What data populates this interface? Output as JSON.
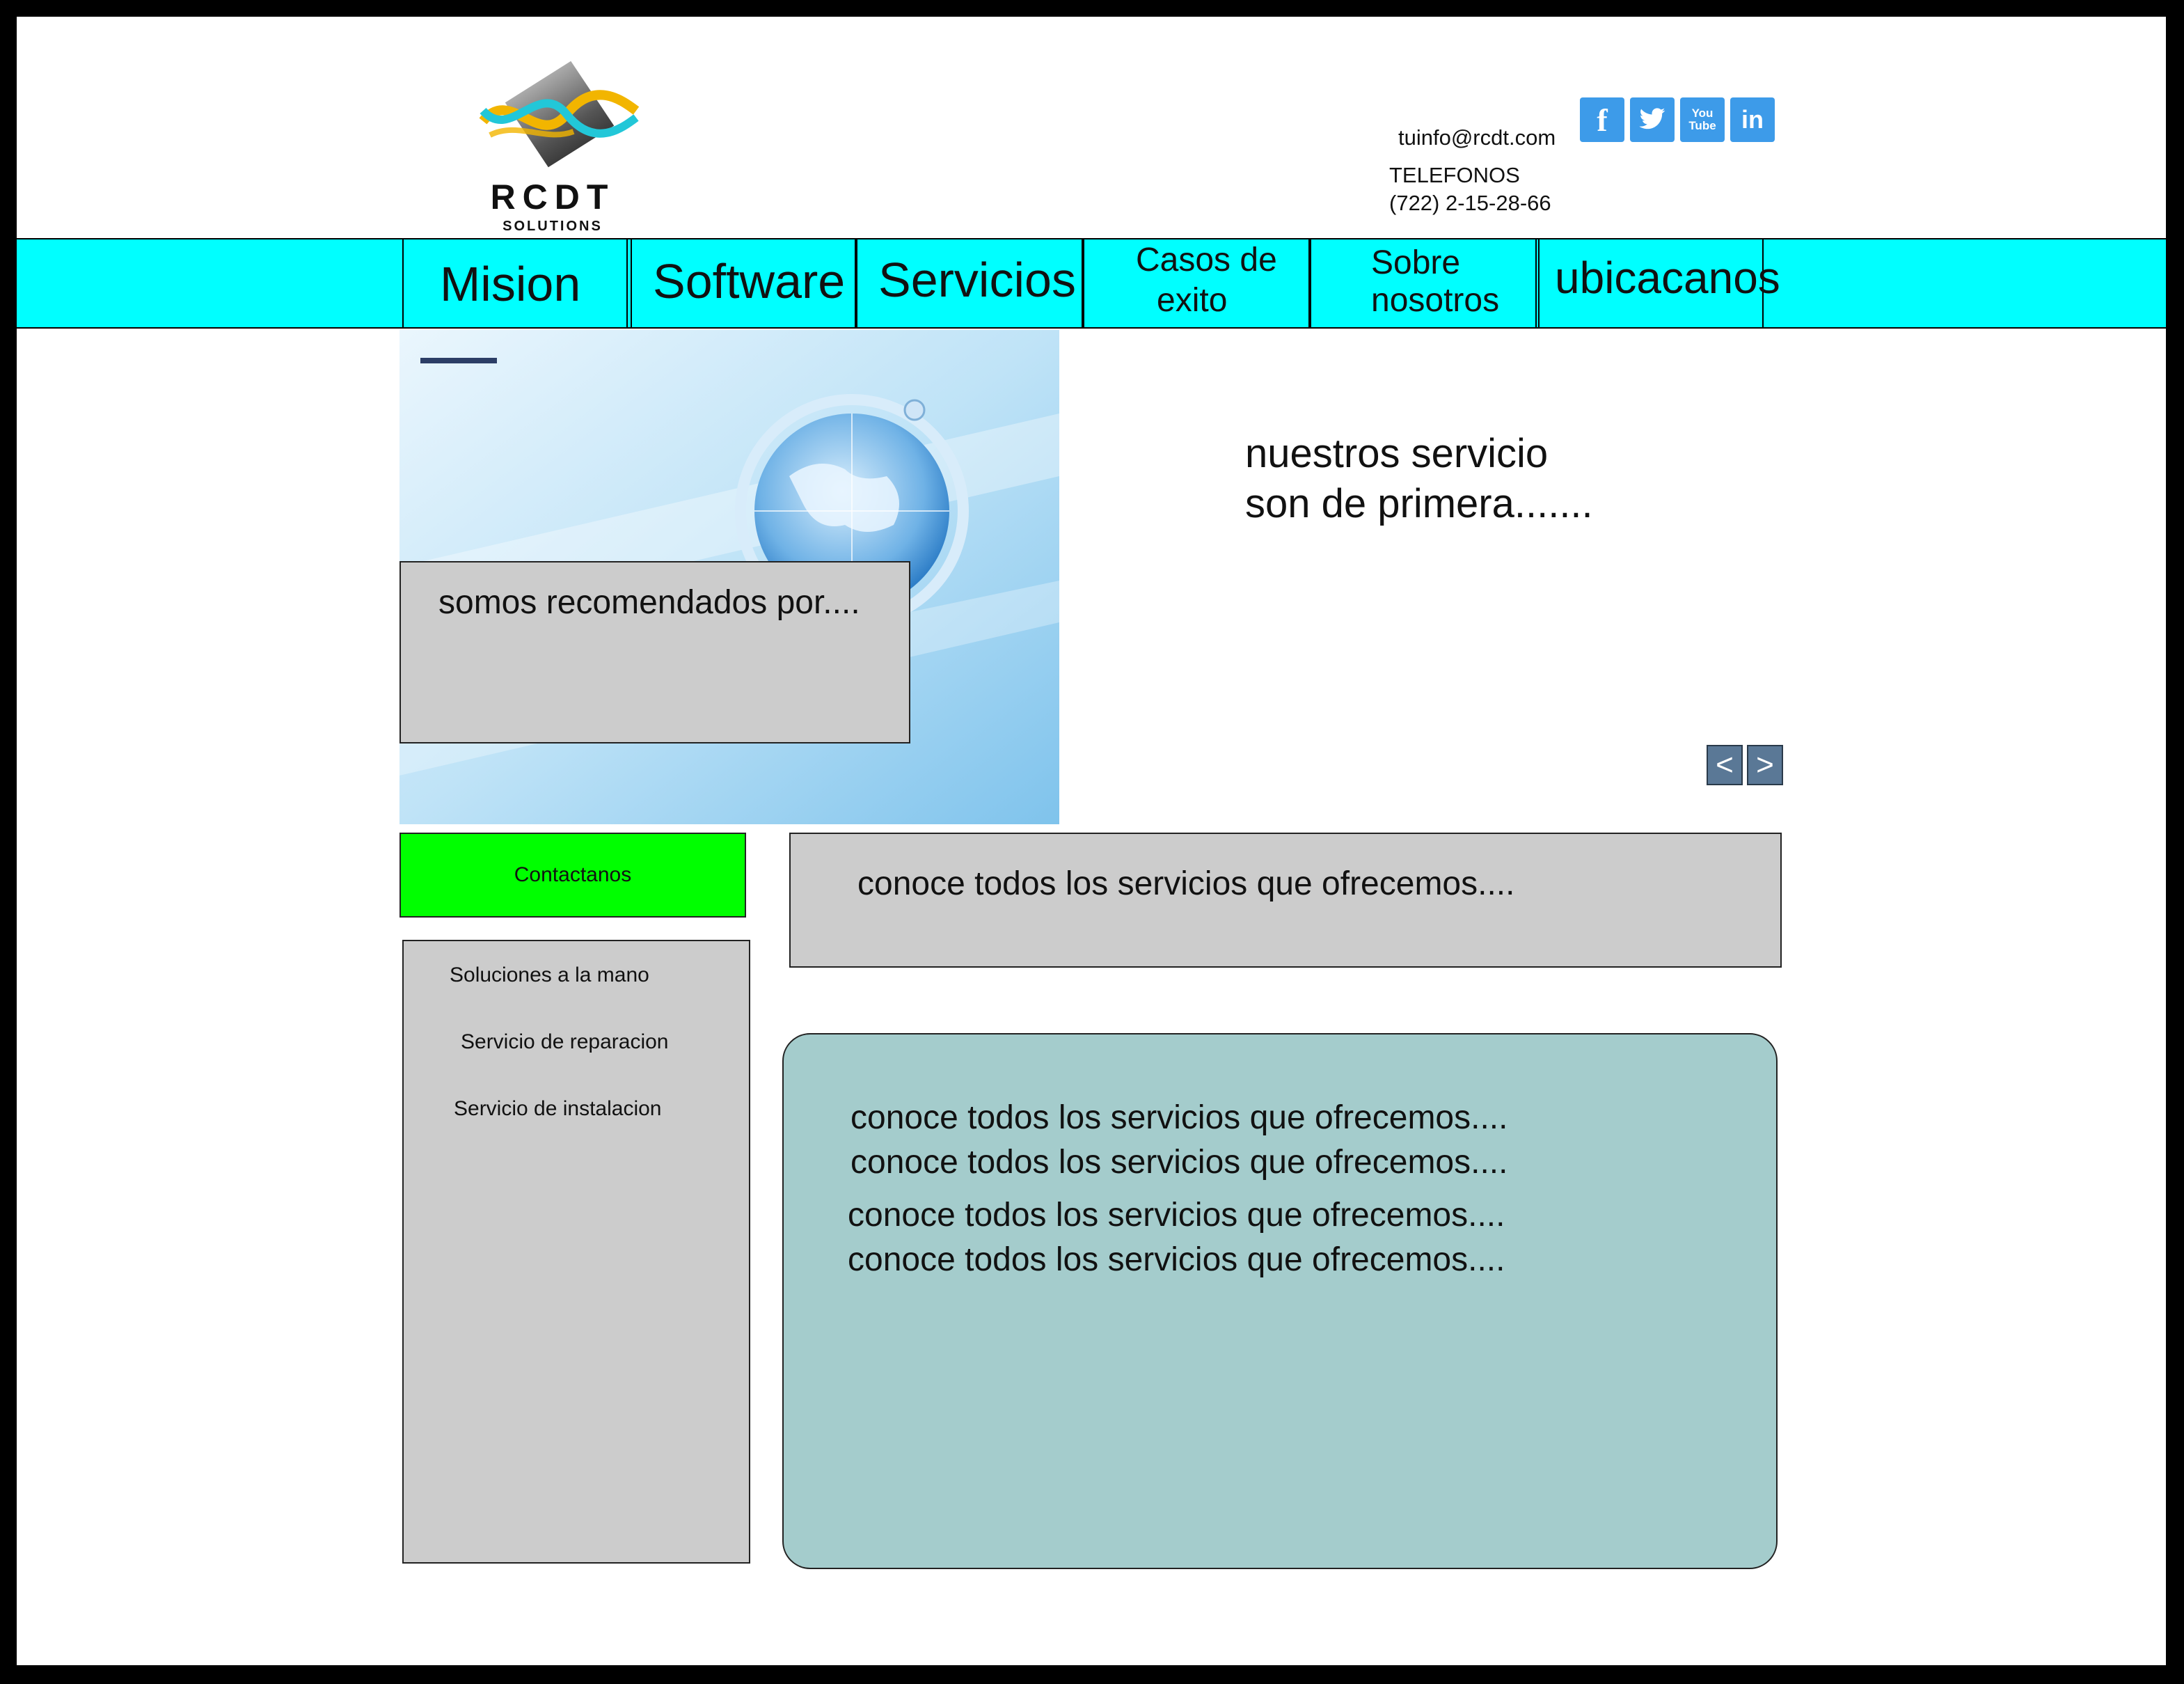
{
  "header": {
    "logo": {
      "word": "RCDT",
      "sub": "SOLUTIONS"
    },
    "email": "tuinfo@rcdt.com",
    "phone_label": "TELEFONOS",
    "phone": "(722)  2-15-28-66",
    "social": [
      {
        "icon": "facebook-icon",
        "glyph": "f"
      },
      {
        "icon": "twitter-icon",
        "glyph": "t"
      },
      {
        "icon": "youtube-icon",
        "glyph": "You Tube"
      },
      {
        "icon": "linkedin-icon",
        "glyph": "in"
      }
    ]
  },
  "nav": {
    "items": [
      {
        "label": "Mision"
      },
      {
        "label": "Software"
      },
      {
        "label": "Servicios"
      },
      {
        "label_line1": "Casos de",
        "label_line2": "exito"
      },
      {
        "label_line1": "Sobre",
        "label_line2": "nosotros"
      },
      {
        "label": "ubicacanos"
      }
    ]
  },
  "hero": {
    "overlay_text": "somos recomendados por....",
    "headline_line1": "nuestros servicio",
    "headline_line2": "son de primera.......",
    "prev": "<",
    "next": ">"
  },
  "contact_button": "Contactanos",
  "sidebar": {
    "links": [
      "Soluciones a la mano",
      "Servicio de reparacion",
      "Servicio de instalacion"
    ]
  },
  "services_banner": "conoce todos los servicios que ofrecemos....",
  "services_list": [
    "conoce todos los servicios que ofrecemos....",
    "conoce todos los servicios que ofrecemos....",
    "conoce todos los servicios que ofrecemos....",
    "conoce todos los servicios que ofrecemos...."
  ],
  "colors": {
    "nav_bg": "#00ffff",
    "contact_bg": "#00ff00",
    "panel_grey": "#cccccc",
    "teal_panel": "#a4cccc",
    "social_blue": "#3d9be9"
  }
}
